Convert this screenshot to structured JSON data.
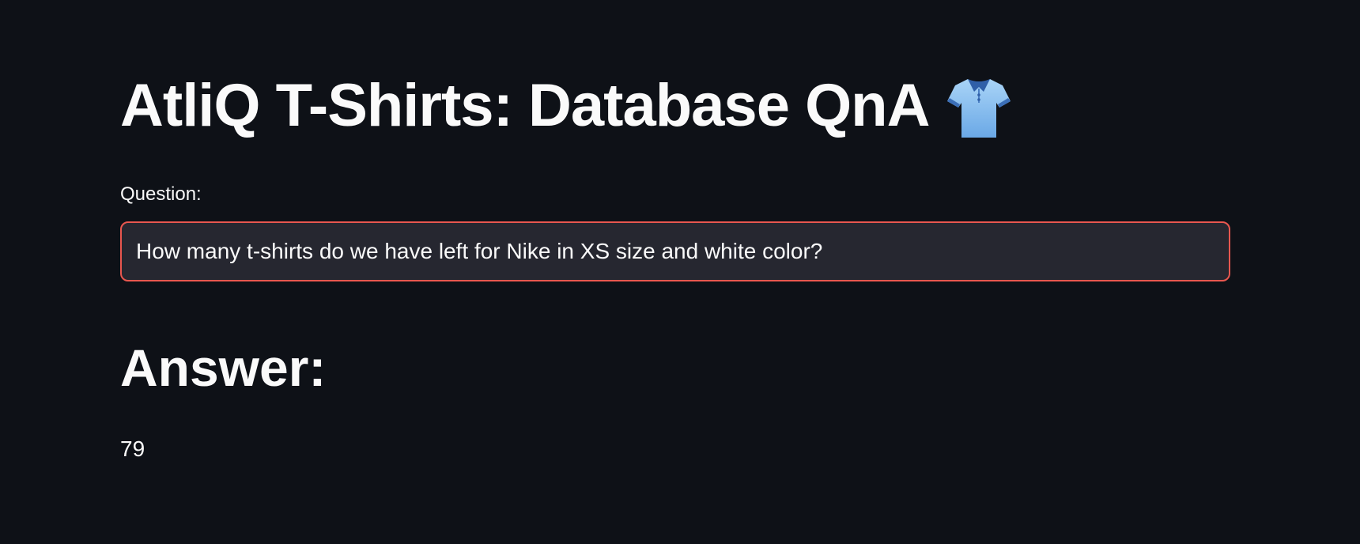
{
  "header": {
    "title": "AtliQ T-Shirts: Database QnA",
    "title_icon": "polo-shirt-icon"
  },
  "question": {
    "label": "Question:",
    "value": "How many t-shirts do we have left for Nike in XS size and white color?",
    "focused_border_color": "#e8574f"
  },
  "answer": {
    "heading": "Answer:",
    "value": "79"
  },
  "theme": {
    "background": "#0e1117",
    "input_background": "#262730",
    "text": "#fafafa"
  }
}
